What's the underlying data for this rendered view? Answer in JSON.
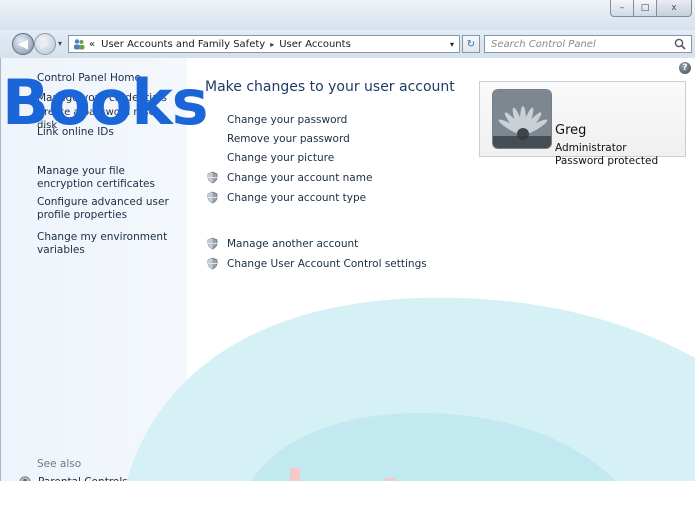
{
  "window": {
    "minimize_glyph": "–",
    "maximize_glyph": "□",
    "close_glyph": "x"
  },
  "nav": {
    "back_glyph": "◀",
    "forward_glyph": "▶",
    "breadcrumb_prefix": "«",
    "breadcrumb": [
      "User Accounts and Family Safety",
      "User Accounts"
    ],
    "breadcrumb_sep": "▸",
    "address_dropdown": "▾",
    "refresh_glyph": "↻",
    "search_placeholder": "Search Control Panel"
  },
  "left": {
    "links": [
      {
        "label": "Control Panel Home"
      },
      {
        "label": "Manage your credentials"
      },
      {
        "label": "Create a password reset disk"
      },
      {
        "label": "Link online IDs"
      },
      {
        "label": "Manage your file encryption certificates"
      },
      {
        "label": "Configure advanced user profile properties"
      },
      {
        "label": "Change my environment variables"
      }
    ],
    "see_also": "See also",
    "parental_controls": "Parental Controls"
  },
  "main": {
    "heading": "Make changes to your user account",
    "tasks": [
      {
        "label": "Change your password",
        "shield": false
      },
      {
        "label": "Remove your password",
        "shield": false
      },
      {
        "label": "Change your picture",
        "shield": false
      },
      {
        "label": "Change your account name",
        "shield": true
      },
      {
        "label": "Change your account type",
        "shield": true
      }
    ],
    "more_tasks": [
      {
        "label": "Manage another account",
        "shield": true
      },
      {
        "label": "Change User Account Control settings",
        "shield": true
      }
    ],
    "help_glyph": "?"
  },
  "account": {
    "name": "Greg",
    "type": "Administrator",
    "status": "Password protected"
  },
  "watermark": "Books",
  "colors": {
    "link": "#1c2d44",
    "heading": "#1f3b66",
    "watermark": "#1a66d9",
    "left_pane": "#eef4fb"
  }
}
